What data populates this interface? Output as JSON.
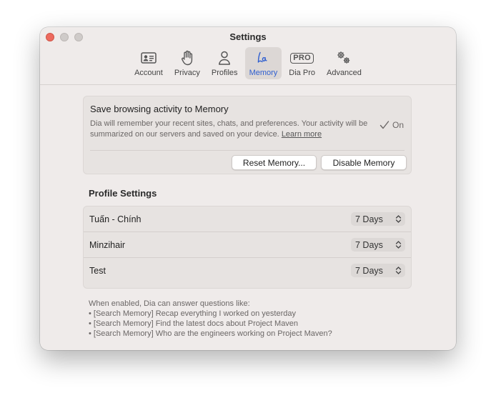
{
  "window": {
    "title": "Settings"
  },
  "tabs": [
    {
      "label": "Account",
      "icon": "account-card-icon"
    },
    {
      "label": "Privacy",
      "icon": "hand-icon"
    },
    {
      "label": "Profiles",
      "icon": "person-icon"
    },
    {
      "label": "Memory",
      "icon": "memory-script-icon",
      "active": true
    },
    {
      "label": "Dia Pro",
      "icon": "pro-badge-icon",
      "badge": "PRO"
    },
    {
      "label": "Advanced",
      "icon": "gears-icon"
    }
  ],
  "memory": {
    "title": "Save browsing activity to Memory",
    "description": "Dia will remember your recent sites, chats, and preferences. Your activity will be summarized on our servers and saved on your device.",
    "learn_more": "Learn more",
    "status": "On",
    "reset_button": "Reset Memory...",
    "disable_button": "Disable Memory"
  },
  "profile_settings": {
    "title": "Profile Settings",
    "profiles": [
      {
        "name": "Tuấn - Chính",
        "retention": "7 Days"
      },
      {
        "name": "Minzihair",
        "retention": "7 Days"
      },
      {
        "name": "Test",
        "retention": "7 Days"
      }
    ]
  },
  "footnote": {
    "intro": "When enabled, Dia can answer questions like:",
    "examples": [
      "• [Search Memory] Recap everything I worked on yesterday",
      "• [Search Memory] Find the latest docs about Project Maven",
      "• [Search Memory] Who are the engineers working on Project Maven?"
    ]
  },
  "colors": {
    "accent": "#2f5fd0",
    "close": "#ed6a5e",
    "window_bg": "#efebea"
  }
}
